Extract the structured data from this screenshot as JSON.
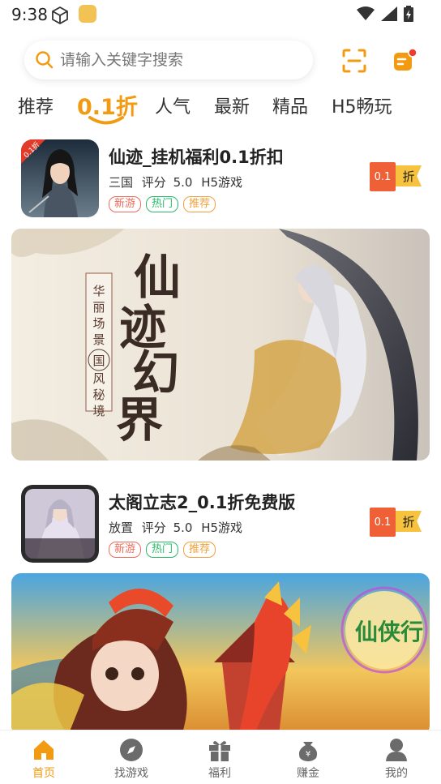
{
  "status_bar": {
    "time": "9:38"
  },
  "search": {
    "placeholder": "请输入关键字搜索"
  },
  "tabs": [
    {
      "label": "推荐"
    },
    {
      "label": "0.1折"
    },
    {
      "label": "人气"
    },
    {
      "label": "最新"
    },
    {
      "label": "精品"
    },
    {
      "label": "H5畅玩"
    }
  ],
  "active_tab_index": 1,
  "games": [
    {
      "title": "仙迹_挂机福利0.1折扣",
      "icon_badge": "0.1折",
      "category": "三国",
      "rating_label": "评分",
      "rating": "5.0",
      "platform": "H5游戏",
      "tags": [
        "新游",
        "热门",
        "推荐"
      ],
      "discount_value": "0.1",
      "discount_unit": "折"
    },
    {
      "title": "太阁立志2_0.1折免费版",
      "icon_badge": "",
      "category": "放置",
      "rating_label": "评分",
      "rating": "5.0",
      "platform": "H5游戏",
      "tags": [
        "新游",
        "热门",
        "推荐"
      ],
      "discount_value": "0.1",
      "discount_unit": "折"
    }
  ],
  "banners": [
    {
      "title": "仙迹幻界",
      "side_text": "华丽场景",
      "side_text_2": "国风秘境"
    },
    {
      "logo_text": "仙侠行"
    }
  ],
  "bottom_nav": [
    {
      "label": "首页",
      "icon": "home-icon"
    },
    {
      "label": "找游戏",
      "icon": "compass-icon"
    },
    {
      "label": "福利",
      "icon": "gift-icon"
    },
    {
      "label": "赚金",
      "icon": "coin-bag-icon"
    },
    {
      "label": "我的",
      "icon": "user-icon"
    }
  ],
  "colors": {
    "accent": "#f29b12",
    "discount_red": "#ef6036",
    "discount_yellow": "#f7c23e"
  }
}
